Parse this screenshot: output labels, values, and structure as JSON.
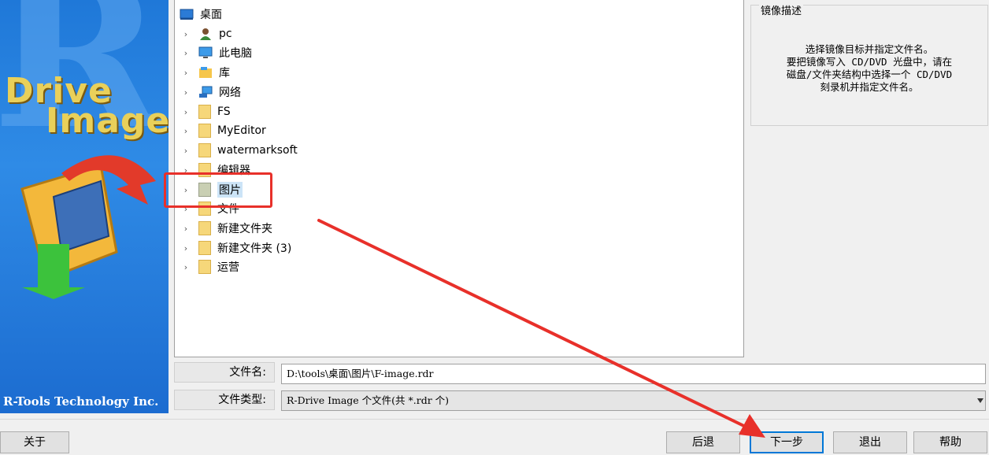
{
  "brand": {
    "title_line1": "Drive",
    "title_line2": "Image",
    "letter": "R",
    "company": "R-Tools Technology Inc."
  },
  "tree": {
    "root": {
      "label": "桌面",
      "icon": "desktop-icon"
    },
    "items": [
      {
        "label": "pc",
        "icon": "user-icon"
      },
      {
        "label": "此电脑",
        "icon": "computer-icon"
      },
      {
        "label": "库",
        "icon": "library-icon"
      },
      {
        "label": "网络",
        "icon": "network-icon"
      },
      {
        "label": "FS",
        "icon": "folder-icon"
      },
      {
        "label": "MyEditor",
        "icon": "folder-icon"
      },
      {
        "label": "watermarksoft",
        "icon": "folder-icon"
      },
      {
        "label": "编辑器",
        "icon": "folder-icon"
      },
      {
        "label": "图片",
        "icon": "folder-icon",
        "selected": true
      },
      {
        "label": "文件",
        "icon": "folder-icon"
      },
      {
        "label": "新建文件夹",
        "icon": "folder-icon"
      },
      {
        "label": "新建文件夹 (3)",
        "icon": "folder-icon"
      },
      {
        "label": "运营",
        "icon": "folder-icon"
      }
    ]
  },
  "description": {
    "caption": "镜像描述",
    "line1": "选择镜像目标并指定文件名。",
    "line2": "要把镜像写入 CD/DVD 光盘中，请在",
    "line3": "磁盘/文件夹结构中选择一个 CD/DVD",
    "line4": "刻录机并指定文件名。"
  },
  "file": {
    "name_label": "文件名:",
    "name_value": "D:\\tools\\桌面\\图片\\F-image.rdr",
    "type_label": "文件类型:",
    "type_value": "R-Drive Image 个文件(共 *.rdr 个)"
  },
  "buttons": {
    "about": "关于",
    "back": "后退",
    "next": "下一步",
    "exit": "退出",
    "help": "帮助"
  },
  "colors": {
    "accent": "#0078d7",
    "annotation": "#e8302a",
    "brand_blue": "#1f78d8"
  }
}
